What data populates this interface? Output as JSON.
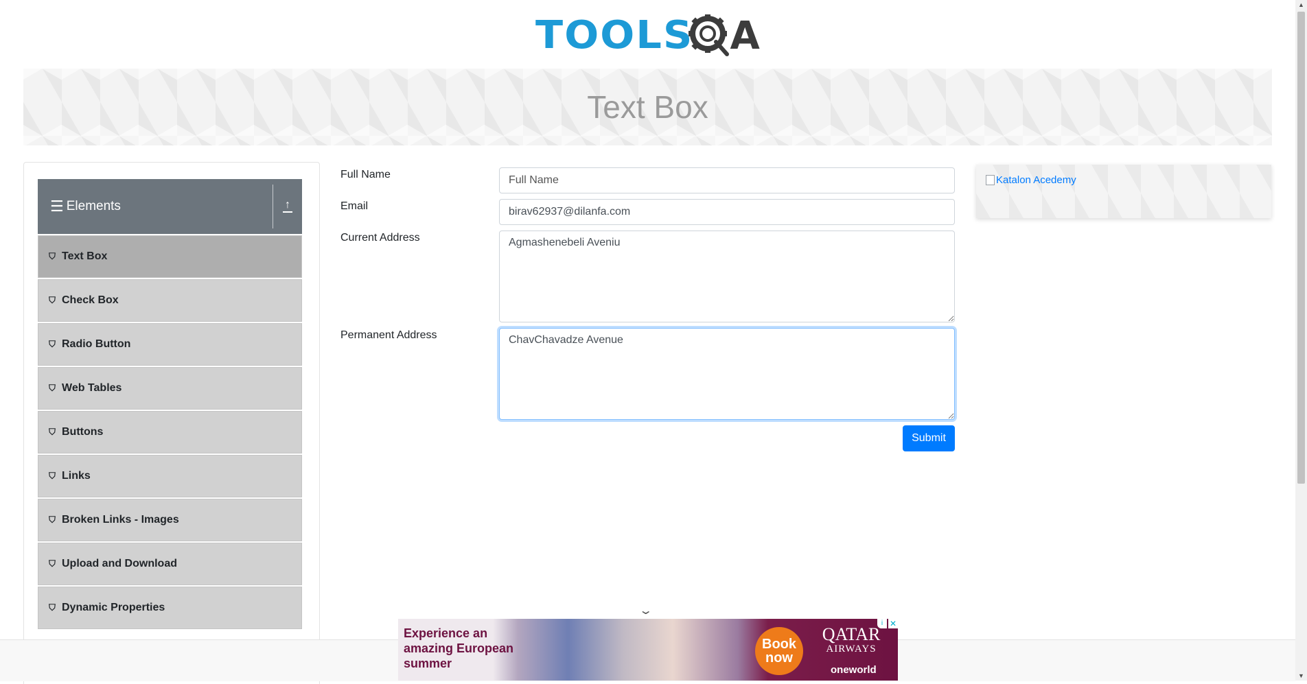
{
  "logo": {
    "part1": "TOOLS",
    "part2": "QA"
  },
  "banner": {
    "title": "Text Box"
  },
  "sidebar": {
    "group_title": "Elements",
    "items": [
      {
        "label": "Text Box",
        "active": true
      },
      {
        "label": "Check Box"
      },
      {
        "label": "Radio Button"
      },
      {
        "label": "Web Tables"
      },
      {
        "label": "Buttons"
      },
      {
        "label": "Links"
      },
      {
        "label": "Broken Links - Images"
      },
      {
        "label": "Upload and Download"
      },
      {
        "label": "Dynamic Properties"
      }
    ]
  },
  "form": {
    "full_name": {
      "label": "Full Name",
      "placeholder": "Full Name",
      "value": ""
    },
    "email": {
      "label": "Email",
      "value": "birav62937@dilanfa.com"
    },
    "current_address": {
      "label": "Current Address",
      "value": "Agmashenebeli Aveniu"
    },
    "permanent_address": {
      "label": "Permanent Address",
      "value": "ChavChavadze Avenue"
    },
    "submit_label": "Submit"
  },
  "side_ad": {
    "alt_text": "Katalon Acedemy"
  },
  "bottom_ad": {
    "headline": "Experience an amazing European summer",
    "cta": "Book now",
    "brand": "QATAR",
    "brand_sub": "AIRWAYS",
    "alliance": "oneworld",
    "close": "✕",
    "info": "i"
  },
  "colors": {
    "accent": "#007bff",
    "sidebar_header": "#6c757d",
    "menu_item": "#d1d1d1",
    "menu_item_active": "#aeaeae",
    "logo_blue": "#1d9ad6",
    "ad_brand": "#6d1241"
  },
  "icons": {
    "menu": "hamburger-icon",
    "collapse": "collapse-arrow-icon",
    "menu_item": "html5-shield-icon",
    "chevron": "chevron-down-icon"
  }
}
